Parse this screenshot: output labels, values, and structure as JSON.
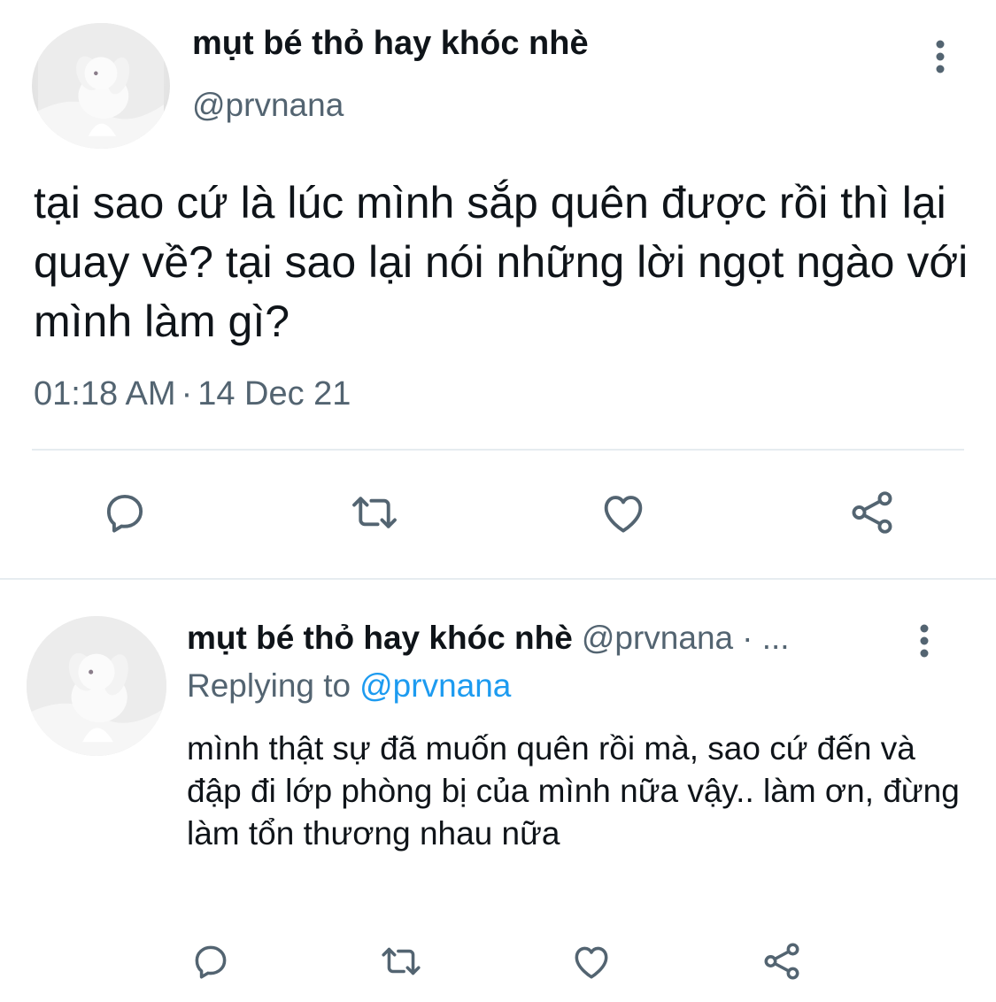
{
  "tweet": {
    "author_name": "mụt bé thỏ hay khóc nhè",
    "author_handle": "@prvnana",
    "text": "tại sao cứ là lúc mình sắp quên được rồi thì lại quay về? tại sao lại nói những lời ngọt ngào với mình làm gì?",
    "time": "01:18 AM",
    "separator": "·",
    "date": "14 Dec 21",
    "actions": [
      "reply-icon",
      "retweet-icon",
      "like-icon",
      "share-icon"
    ]
  },
  "reply": {
    "author_name": "mụt bé thỏ hay khóc nhè",
    "author_handle": "@prvnana",
    "dot": "· ...",
    "replying_label": "Replying to",
    "replying_to": "@prvnana",
    "text": "mình thật sự đã muốn quên rồi mà, sao cứ đến và đập đi lớp phòng bị của mình nữa vậy.. làm ơn, đừng làm tổn thương nhau nữa",
    "actions": [
      "reply-icon",
      "retweet-icon",
      "like-icon",
      "share-icon"
    ]
  },
  "colors": {
    "text": "#0f1419",
    "secondary": "#536471",
    "link": "#1d9bf0",
    "divider": "#e6ecf0"
  }
}
